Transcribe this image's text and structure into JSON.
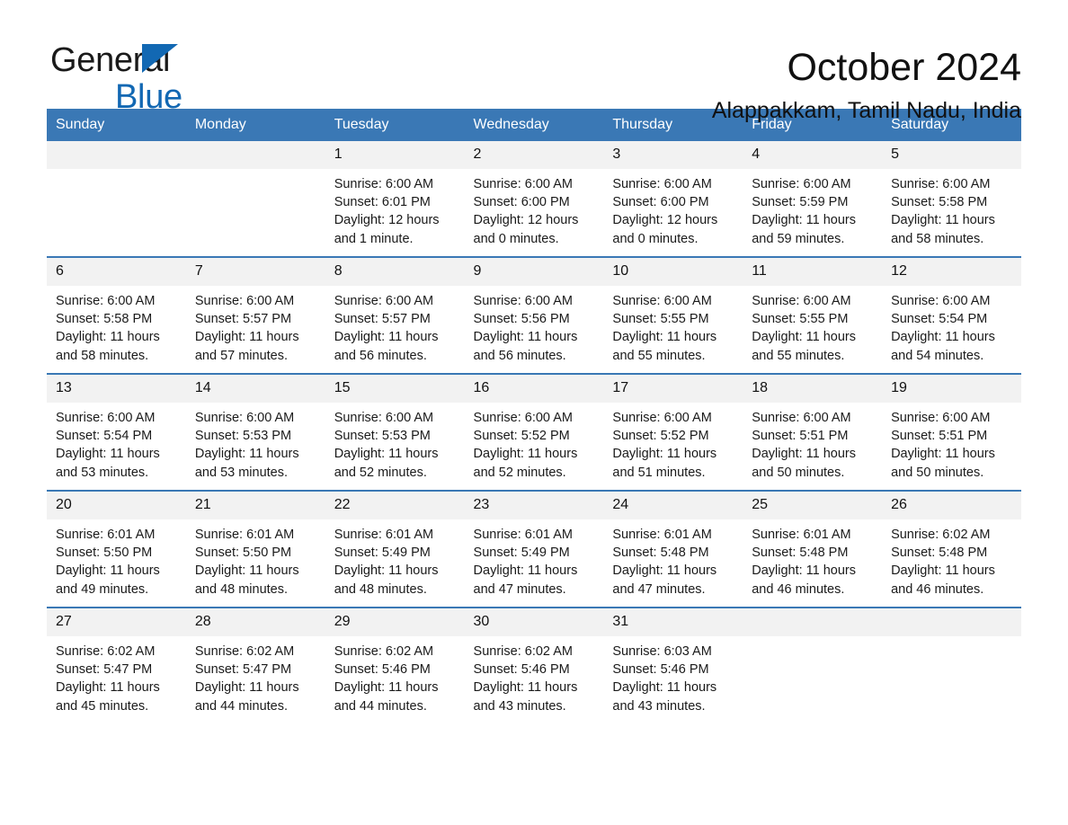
{
  "brand": {
    "line1": "General",
    "line2": "Blue",
    "triangle_color": "#1268b3"
  },
  "header": {
    "title": "October 2024",
    "subtitle": "Alappakkam, Tamil Nadu, India"
  },
  "theme": {
    "header_blue": "#3a78b5",
    "daynum_bg": "#f2f2f2",
    "text": "#1a1a1a"
  },
  "weekday_headers": [
    "Sunday",
    "Monday",
    "Tuesday",
    "Wednesday",
    "Thursday",
    "Friday",
    "Saturday"
  ],
  "weeks": [
    [
      {
        "blank": true
      },
      {
        "blank": true
      },
      {
        "day": "1",
        "sunrise": "Sunrise: 6:00 AM",
        "sunset": "Sunset: 6:01 PM",
        "daylight1": "Daylight: 12 hours",
        "daylight2": "and 1 minute."
      },
      {
        "day": "2",
        "sunrise": "Sunrise: 6:00 AM",
        "sunset": "Sunset: 6:00 PM",
        "daylight1": "Daylight: 12 hours",
        "daylight2": "and 0 minutes."
      },
      {
        "day": "3",
        "sunrise": "Sunrise: 6:00 AM",
        "sunset": "Sunset: 6:00 PM",
        "daylight1": "Daylight: 12 hours",
        "daylight2": "and 0 minutes."
      },
      {
        "day": "4",
        "sunrise": "Sunrise: 6:00 AM",
        "sunset": "Sunset: 5:59 PM",
        "daylight1": "Daylight: 11 hours",
        "daylight2": "and 59 minutes."
      },
      {
        "day": "5",
        "sunrise": "Sunrise: 6:00 AM",
        "sunset": "Sunset: 5:58 PM",
        "daylight1": "Daylight: 11 hours",
        "daylight2": "and 58 minutes."
      }
    ],
    [
      {
        "day": "6",
        "sunrise": "Sunrise: 6:00 AM",
        "sunset": "Sunset: 5:58 PM",
        "daylight1": "Daylight: 11 hours",
        "daylight2": "and 58 minutes."
      },
      {
        "day": "7",
        "sunrise": "Sunrise: 6:00 AM",
        "sunset": "Sunset: 5:57 PM",
        "daylight1": "Daylight: 11 hours",
        "daylight2": "and 57 minutes."
      },
      {
        "day": "8",
        "sunrise": "Sunrise: 6:00 AM",
        "sunset": "Sunset: 5:57 PM",
        "daylight1": "Daylight: 11 hours",
        "daylight2": "and 56 minutes."
      },
      {
        "day": "9",
        "sunrise": "Sunrise: 6:00 AM",
        "sunset": "Sunset: 5:56 PM",
        "daylight1": "Daylight: 11 hours",
        "daylight2": "and 56 minutes."
      },
      {
        "day": "10",
        "sunrise": "Sunrise: 6:00 AM",
        "sunset": "Sunset: 5:55 PM",
        "daylight1": "Daylight: 11 hours",
        "daylight2": "and 55 minutes."
      },
      {
        "day": "11",
        "sunrise": "Sunrise: 6:00 AM",
        "sunset": "Sunset: 5:55 PM",
        "daylight1": "Daylight: 11 hours",
        "daylight2": "and 55 minutes."
      },
      {
        "day": "12",
        "sunrise": "Sunrise: 6:00 AM",
        "sunset": "Sunset: 5:54 PM",
        "daylight1": "Daylight: 11 hours",
        "daylight2": "and 54 minutes."
      }
    ],
    [
      {
        "day": "13",
        "sunrise": "Sunrise: 6:00 AM",
        "sunset": "Sunset: 5:54 PM",
        "daylight1": "Daylight: 11 hours",
        "daylight2": "and 53 minutes."
      },
      {
        "day": "14",
        "sunrise": "Sunrise: 6:00 AM",
        "sunset": "Sunset: 5:53 PM",
        "daylight1": "Daylight: 11 hours",
        "daylight2": "and 53 minutes."
      },
      {
        "day": "15",
        "sunrise": "Sunrise: 6:00 AM",
        "sunset": "Sunset: 5:53 PM",
        "daylight1": "Daylight: 11 hours",
        "daylight2": "and 52 minutes."
      },
      {
        "day": "16",
        "sunrise": "Sunrise: 6:00 AM",
        "sunset": "Sunset: 5:52 PM",
        "daylight1": "Daylight: 11 hours",
        "daylight2": "and 52 minutes."
      },
      {
        "day": "17",
        "sunrise": "Sunrise: 6:00 AM",
        "sunset": "Sunset: 5:52 PM",
        "daylight1": "Daylight: 11 hours",
        "daylight2": "and 51 minutes."
      },
      {
        "day": "18",
        "sunrise": "Sunrise: 6:00 AM",
        "sunset": "Sunset: 5:51 PM",
        "daylight1": "Daylight: 11 hours",
        "daylight2": "and 50 minutes."
      },
      {
        "day": "19",
        "sunrise": "Sunrise: 6:00 AM",
        "sunset": "Sunset: 5:51 PM",
        "daylight1": "Daylight: 11 hours",
        "daylight2": "and 50 minutes."
      }
    ],
    [
      {
        "day": "20",
        "sunrise": "Sunrise: 6:01 AM",
        "sunset": "Sunset: 5:50 PM",
        "daylight1": "Daylight: 11 hours",
        "daylight2": "and 49 minutes."
      },
      {
        "day": "21",
        "sunrise": "Sunrise: 6:01 AM",
        "sunset": "Sunset: 5:50 PM",
        "daylight1": "Daylight: 11 hours",
        "daylight2": "and 48 minutes."
      },
      {
        "day": "22",
        "sunrise": "Sunrise: 6:01 AM",
        "sunset": "Sunset: 5:49 PM",
        "daylight1": "Daylight: 11 hours",
        "daylight2": "and 48 minutes."
      },
      {
        "day": "23",
        "sunrise": "Sunrise: 6:01 AM",
        "sunset": "Sunset: 5:49 PM",
        "daylight1": "Daylight: 11 hours",
        "daylight2": "and 47 minutes."
      },
      {
        "day": "24",
        "sunrise": "Sunrise: 6:01 AM",
        "sunset": "Sunset: 5:48 PM",
        "daylight1": "Daylight: 11 hours",
        "daylight2": "and 47 minutes."
      },
      {
        "day": "25",
        "sunrise": "Sunrise: 6:01 AM",
        "sunset": "Sunset: 5:48 PM",
        "daylight1": "Daylight: 11 hours",
        "daylight2": "and 46 minutes."
      },
      {
        "day": "26",
        "sunrise": "Sunrise: 6:02 AM",
        "sunset": "Sunset: 5:48 PM",
        "daylight1": "Daylight: 11 hours",
        "daylight2": "and 46 minutes."
      }
    ],
    [
      {
        "day": "27",
        "sunrise": "Sunrise: 6:02 AM",
        "sunset": "Sunset: 5:47 PM",
        "daylight1": "Daylight: 11 hours",
        "daylight2": "and 45 minutes."
      },
      {
        "day": "28",
        "sunrise": "Sunrise: 6:02 AM",
        "sunset": "Sunset: 5:47 PM",
        "daylight1": "Daylight: 11 hours",
        "daylight2": "and 44 minutes."
      },
      {
        "day": "29",
        "sunrise": "Sunrise: 6:02 AM",
        "sunset": "Sunset: 5:46 PM",
        "daylight1": "Daylight: 11 hours",
        "daylight2": "and 44 minutes."
      },
      {
        "day": "30",
        "sunrise": "Sunrise: 6:02 AM",
        "sunset": "Sunset: 5:46 PM",
        "daylight1": "Daylight: 11 hours",
        "daylight2": "and 43 minutes."
      },
      {
        "day": "31",
        "sunrise": "Sunrise: 6:03 AM",
        "sunset": "Sunset: 5:46 PM",
        "daylight1": "Daylight: 11 hours",
        "daylight2": "and 43 minutes."
      },
      {
        "blank": true
      },
      {
        "blank": true
      }
    ]
  ]
}
